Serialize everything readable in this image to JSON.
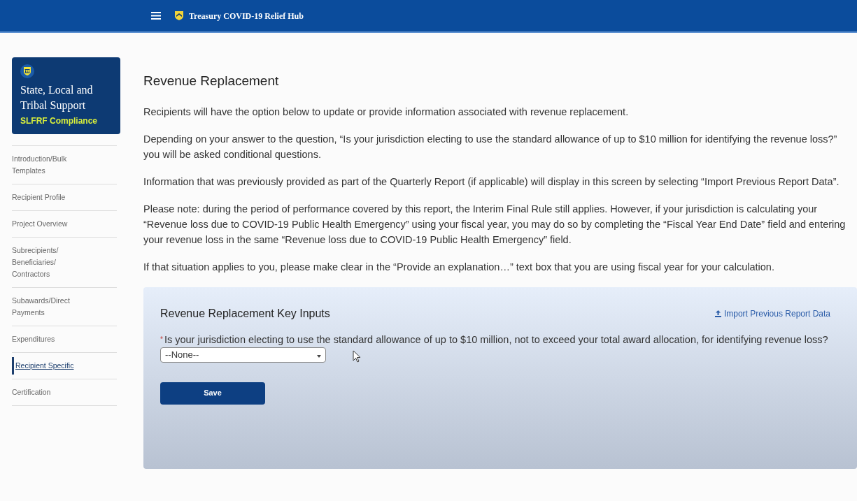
{
  "header": {
    "title": "Treasury COVID-19 Relief Hub"
  },
  "sidebar": {
    "title": "State, Local and Tribal Support",
    "subtitle": "SLFRF Compliance",
    "items": [
      {
        "label": "Introduction/Bulk Templates",
        "selected": false
      },
      {
        "label": "Recipient Profile",
        "selected": false
      },
      {
        "label": "Project Overview",
        "selected": false
      },
      {
        "label": "Subrecipients/ Beneficiaries/ Contractors",
        "selected": false
      },
      {
        "label": "Subawards/Direct Payments",
        "selected": false
      },
      {
        "label": "Expenditures",
        "selected": false
      },
      {
        "label": "Recipient Specific",
        "selected": true
      },
      {
        "label": "Certification",
        "selected": false
      }
    ]
  },
  "main": {
    "heading": "Revenue Replacement",
    "paragraphs": [
      "Recipients will have the option below to update or provide information associated with revenue replacement.",
      "Depending on your answer to the question, “Is your jurisdiction electing to use the standard allowance of up to $10 million for identifying the revenue loss?” you will be asked conditional questions.",
      "Information that was previously provided as part of the Quarterly Report (if applicable) will display in this screen by selecting “Import Previous Report Data”.",
      "Please note: during the period of performance covered by this report, the Interim Final Rule still applies. However, if your jurisdiction is calculating your “Revenue loss due to COVID-19 Public Health Emergency” using your fiscal year, you may do so by completing the “Fiscal Year End Date” field and entering your revenue loss in the same “Revenue loss due to COVID-19 Public Health Emergency” field.",
      "If that situation applies to you, please make clear in the “Provide an explanation…” text box that you are using fiscal year for your calculation."
    ]
  },
  "panel": {
    "title": "Revenue Replacement Key Inputs",
    "import_link": "Import Previous Report Data",
    "required": true,
    "required_mark": "*",
    "question": "Is your jurisdiction electing to use the standard allowance of up to $10 million, not to exceed your total award allocation, for identifying revenue loss?",
    "select_value": "--None--",
    "save_button": "Save"
  }
}
